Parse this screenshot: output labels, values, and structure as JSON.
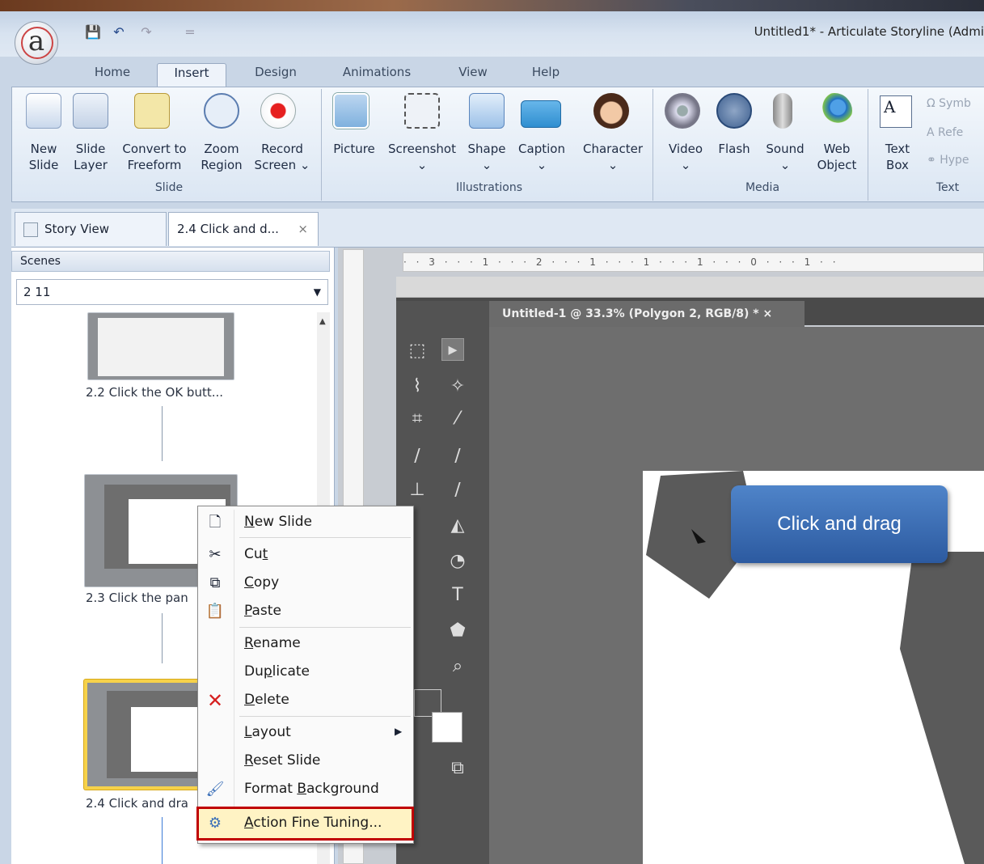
{
  "window": {
    "title": "Untitled1* - Articulate Storyline (Admi"
  },
  "app_button": {
    "label": "a"
  },
  "quick_access": [
    "save-icon",
    "undo-icon",
    "redo-icon",
    "customize-icon"
  ],
  "tabs": [
    "Home",
    "Insert",
    "Design",
    "Animations",
    "View",
    "Help"
  ],
  "active_tab": "Insert",
  "ribbon": {
    "slide": {
      "label": "Slide",
      "buttons": [
        {
          "l1": "New",
          "l2": "Slide"
        },
        {
          "l1": "Slide",
          "l2": "Layer"
        },
        {
          "l1": "Convert to",
          "l2": "Freeform"
        },
        {
          "l1": "Zoom",
          "l2": "Region"
        },
        {
          "l1": "Record",
          "l2": "Screen ⌄"
        }
      ]
    },
    "illustrations": {
      "label": "Illustrations",
      "buttons": [
        {
          "l1": "Picture",
          "l2": ""
        },
        {
          "l1": "Screenshot",
          "l2": "⌄"
        },
        {
          "l1": "Shape",
          "l2": "⌄"
        },
        {
          "l1": "Caption",
          "l2": "⌄"
        },
        {
          "l1": "Character",
          "l2": "⌄"
        }
      ]
    },
    "media": {
      "label": "Media",
      "buttons": [
        {
          "l1": "Video",
          "l2": "⌄"
        },
        {
          "l1": "Flash",
          "l2": ""
        },
        {
          "l1": "Sound",
          "l2": "⌄"
        },
        {
          "l1": "Web",
          "l2": "Object"
        }
      ]
    },
    "text": {
      "label": "Text",
      "buttons": [
        {
          "l1": "Text",
          "l2": "Box"
        }
      ],
      "small": [
        "Symb",
        "Refe",
        "Hype"
      ]
    }
  },
  "doc_tabs": [
    {
      "label": "Story View"
    },
    {
      "label": "2.4 Click and d..."
    }
  ],
  "doc_tab_close": "×",
  "scenes": {
    "header": "Scenes",
    "selected": "2 11"
  },
  "slides": [
    {
      "label": "2.2 Click the OK butt..."
    },
    {
      "label": "2.3 Click the pan"
    },
    {
      "label": "2.4 Click and dra"
    }
  ],
  "photoshop": {
    "doc_tab": "Untitled-1 @ 33.3% (Polygon 2, RGB/8) * ×",
    "ruler": "· · 3 · · · 1 · · · 2 · · · 1 · · · 1 · · · 1 · · · 0 · · · 1 · ·"
  },
  "callout": {
    "text": "Click and drag"
  },
  "context_menu": [
    {
      "icon": "new-slide-icon",
      "pre": "",
      "u": "N",
      "post": "ew Slide"
    },
    {
      "icon": "cut-icon",
      "pre": "Cu",
      "u": "t",
      "post": ""
    },
    {
      "icon": "copy-icon",
      "pre": "",
      "u": "C",
      "post": "opy"
    },
    {
      "icon": "paste-icon",
      "pre": "",
      "u": "P",
      "post": "aste"
    },
    {
      "icon": "",
      "pre": "",
      "u": "R",
      "post": "ename"
    },
    {
      "icon": "",
      "pre": "Du",
      "u": "p",
      "post": "licate"
    },
    {
      "icon": "delete-icon",
      "pre": "",
      "u": "D",
      "post": "elete"
    },
    {
      "icon": "",
      "pre": "",
      "u": "L",
      "post": "ayout"
    },
    {
      "icon": "",
      "pre": "",
      "u": "R",
      "post": "eset Slide"
    },
    {
      "icon": "format-background-icon",
      "pre": "Format ",
      "u": "B",
      "post": "ackground"
    },
    {
      "icon": "action-fine-tuning-icon",
      "pre": "",
      "u": "A",
      "post": "ction Fine Tuning..."
    }
  ],
  "highlight_color": "#c00000"
}
